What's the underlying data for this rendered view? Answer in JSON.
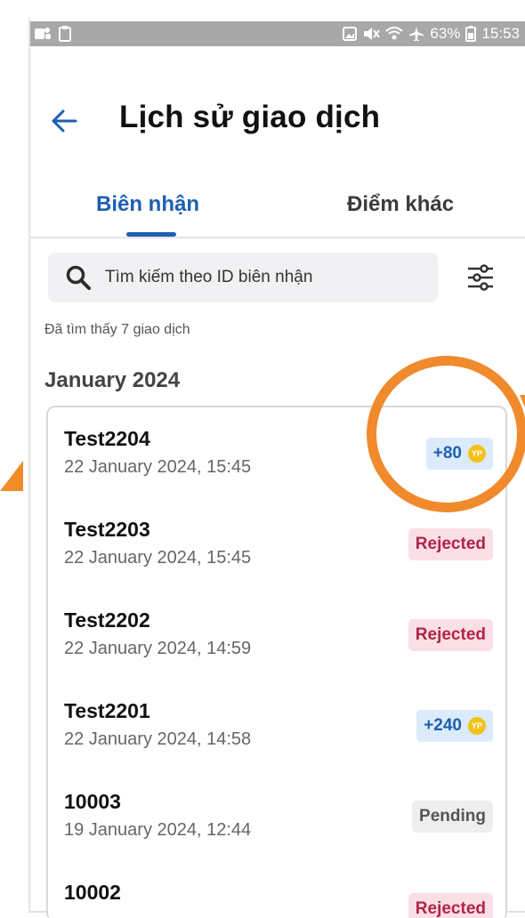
{
  "status_bar": {
    "battery": "63%",
    "time": "15:53"
  },
  "header": {
    "title": "Lịch sử giao dịch"
  },
  "tabs": [
    {
      "label": "Biên nhận",
      "active": true
    },
    {
      "label": "Điểm khác",
      "active": false
    }
  ],
  "search": {
    "placeholder": "Tìm kiếm theo ID biên nhận"
  },
  "result_count": "Đã tìm thấy 7 giao dịch",
  "month_header": "January 2024",
  "transactions": [
    {
      "id": "Test2204",
      "date": "22 January 2024, 15:45",
      "status": "+80",
      "type": "points"
    },
    {
      "id": "Test2203",
      "date": "22 January 2024, 15:45",
      "status": "Rejected",
      "type": "rejected"
    },
    {
      "id": "Test2202",
      "date": "22 January 2024, 14:59",
      "status": "Rejected",
      "type": "rejected"
    },
    {
      "id": "Test2201",
      "date": "22 January 2024, 14:58",
      "status": "+240",
      "type": "points"
    },
    {
      "id": "10003",
      "date": "19 January 2024, 12:44",
      "status": "Pending",
      "type": "pending"
    },
    {
      "id": "10002",
      "date": "",
      "status": "Rejected",
      "type": "rejected"
    }
  ],
  "coin_label": "YP",
  "colors": {
    "accent": "#1d5fb0",
    "points_bg": "#dcebfa",
    "rejected_bg": "#fbdfe6",
    "rejected_text": "#b22448",
    "pending_bg": "#eeeeee",
    "coin": "#f2c21b",
    "annotation": "#f08a2c"
  }
}
